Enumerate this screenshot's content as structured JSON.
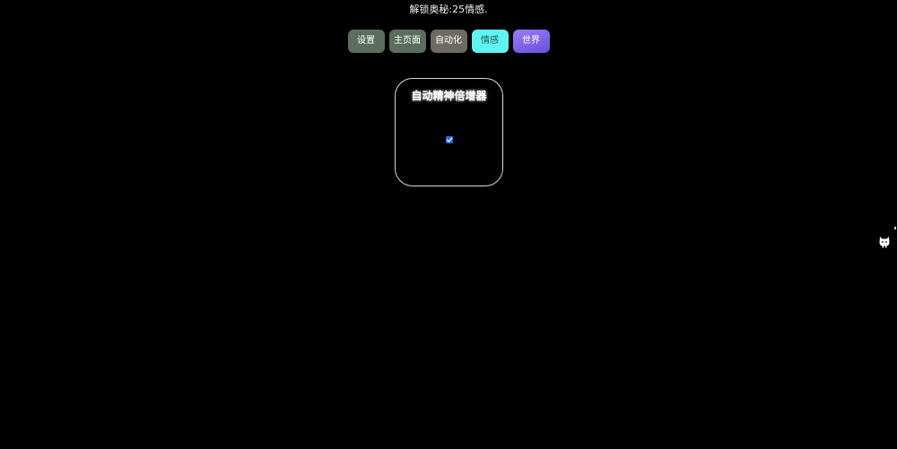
{
  "header": {
    "unlock_hint": "解锁奥秘:25情感."
  },
  "tabs": [
    {
      "key": "settings",
      "label": "设置"
    },
    {
      "key": "home",
      "label": "主页面"
    },
    {
      "key": "auto",
      "label": "自动化"
    },
    {
      "key": "emotion",
      "label": "情感",
      "active": true
    },
    {
      "key": "world",
      "label": "世界"
    }
  ],
  "card": {
    "title": "自动精神倍增器",
    "checked": true
  },
  "colors": {
    "background": "#000000",
    "tab_settings": "#5b6e5e",
    "tab_home": "#5b6e5e",
    "tab_auto": "#6e6a62",
    "tab_emotion": "#5ff4f2",
    "tab_world": "#7b5cf0",
    "checkbox": "#2e6be6"
  },
  "icons": {
    "side_widget": "cat-icon",
    "checkbox": "checkmark-icon"
  }
}
